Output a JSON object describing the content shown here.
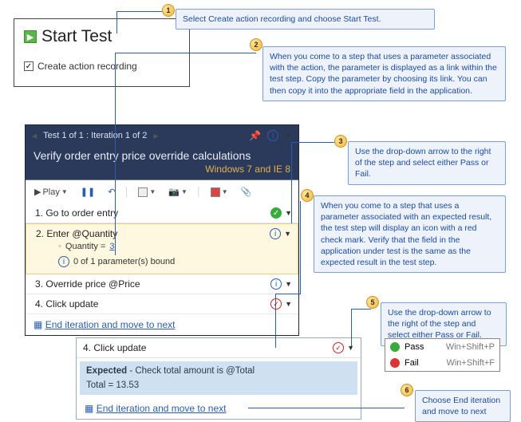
{
  "domain": "Diagram",
  "start_panel": {
    "title": "Start Test",
    "checkbox_label": "Create action recording",
    "checkbox_checked": true
  },
  "callouts": {
    "c1": "Select Create action recording and choose Start Test.",
    "c2": "When you come to a step that uses a parameter associated with the action, the parameter is displayed as a link within the test step. Copy the parameter by choosing its link. You can then copy it into the appropriate field in the application.",
    "c3": "Use the drop-down arrow to the right of the step and select either Pass or Fail.",
    "c4": "When you come to a step that uses a parameter associated with an expected result, the test step will display an icon with a red check mark. Verify that the field in the application under test is the same as the expected result in the test step.",
    "c5": "Use the drop-down arrow to the right of the step and select either Pass or Fail.",
    "c6": "Choose End iteration and move to next"
  },
  "runner": {
    "breadcrumb": "Test 1 of 1 : Iteration 1 of 2",
    "title": "Verify order entry price override calculations",
    "subtitle": "Windows 7 and IE 8",
    "play_label": "Play"
  },
  "steps": [
    {
      "n": "1.",
      "text": "Go to order entry",
      "status": "pass"
    },
    {
      "n": "2.",
      "text": "Enter @Quantity",
      "status": "info",
      "selected": true
    },
    {
      "n": "3.",
      "text": "Override price @Price",
      "status": "info"
    },
    {
      "n": "4.",
      "text": "Click update",
      "status": "pending"
    }
  ],
  "step2_detail": {
    "param_line": {
      "label": "Quantity =",
      "value": "3"
    },
    "bound_line": "0 of 1 parameter(s) bound"
  },
  "footer_link": "End iteration and move to next",
  "detail": {
    "step_n": "4.",
    "step_text": "Click update",
    "expected_label": "Expected",
    "expected_text": " - Check total amount is @Total",
    "total_line": "Total = 13.53",
    "footer": "End iteration and move to next"
  },
  "passfail": {
    "pass_label": "Pass",
    "pass_short": "Win+Shift+P",
    "fail_label": "Fail",
    "fail_short": "Win+Shift+F"
  }
}
